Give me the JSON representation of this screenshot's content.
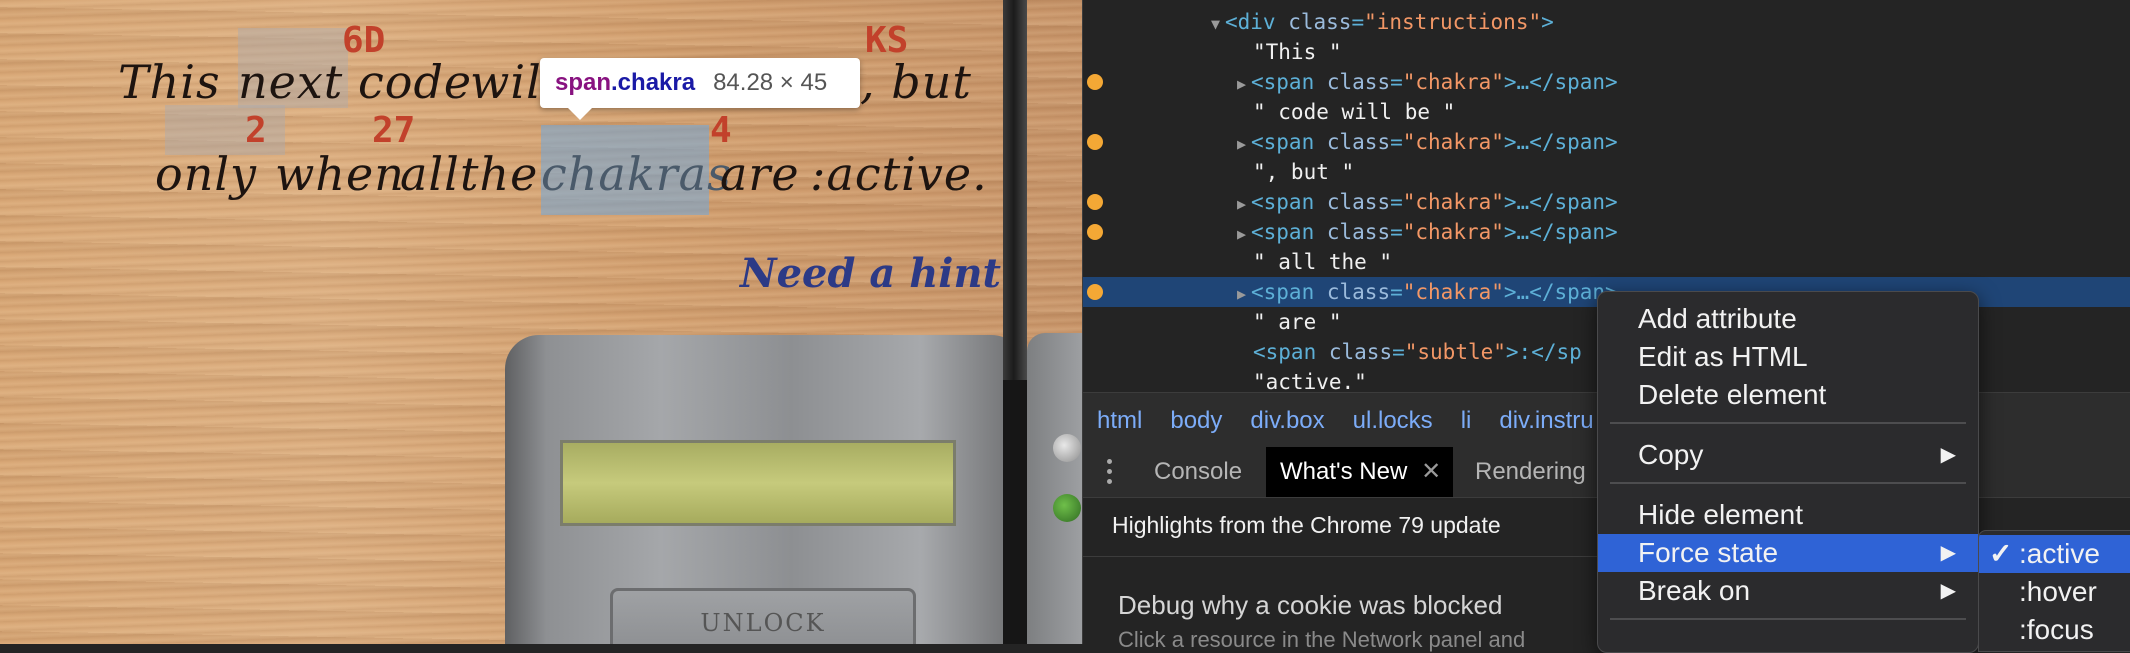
{
  "page": {
    "line1": {
      "w1": "This",
      "w2": "next",
      "w3": "code",
      "w4": "will",
      "w5": ", but"
    },
    "line2": {
      "w1": "only",
      "w2": "when",
      "w3": "all",
      "w4": "the",
      "w5": "chakras",
      "w6": "are",
      "w7": ":active."
    },
    "code_fragments": [
      "6D",
      "KS",
      "2",
      "27",
      "4"
    ],
    "hint_link": "Need a hint?",
    "unlock_button": "UNLOCK"
  },
  "inspect_tooltip": {
    "tag": "span",
    "class": ".chakra",
    "size": "84.28 × 45"
  },
  "elements_panel": {
    "lines": [
      {
        "open": "<div",
        "attr": "class",
        "val": "\"instructions\"",
        "close": ">"
      },
      {
        "text": "\"This \""
      },
      {
        "open": "<span",
        "attr": "class",
        "val": "\"chakra\"",
        "close": ">…</span>"
      },
      {
        "text": "\" code will be \""
      },
      {
        "open": "<span",
        "attr": "class",
        "val": "\"chakra\"",
        "close": ">…</span>"
      },
      {
        "text": "\", but \""
      },
      {
        "open": "<span",
        "attr": "class",
        "val": "\"chakra\"",
        "close": ">…</span>"
      },
      {
        "open": "<span",
        "attr": "class",
        "val": "\"chakra\"",
        "close": ">…</span>"
      },
      {
        "text": "\" all the \""
      },
      {
        "open": "<span",
        "attr": "class",
        "val": "\"chakra\"",
        "close": ">…</span>"
      },
      {
        "text": "\" are \""
      },
      {
        "open": "<span",
        "attr": "class",
        "val": "\"subtle\"",
        "close": ">:</sp"
      },
      {
        "text": "\"active.\""
      }
    ]
  },
  "breadcrumbs": [
    "html",
    "body",
    "div.box",
    "ul.locks",
    "li",
    "div.instru"
  ],
  "drawer": {
    "tabs": [
      "Console",
      "What's New",
      "Rendering"
    ],
    "highlights": "Highlights from the Chrome 79 update",
    "feature_title": "Debug why a cookie was blocked",
    "feature_desc": "Click a resource in the Network panel and"
  },
  "context_menu": {
    "add_attribute": "Add attribute",
    "edit_as_html": "Edit as HTML",
    "delete_element": "Delete element",
    "copy": "Copy",
    "hide_element": "Hide element",
    "force_state": "Force state",
    "break_on": "Break on"
  },
  "force_state_submenu": {
    "check": "✓",
    "active": ":active",
    "hover": ":hover",
    "focus": ":focus"
  },
  "colors": {
    "selection": "#2f63d6",
    "breakpoint_dot": "#f4a835",
    "code_fragment": "#c2412b",
    "hint": "#2c3a86"
  }
}
